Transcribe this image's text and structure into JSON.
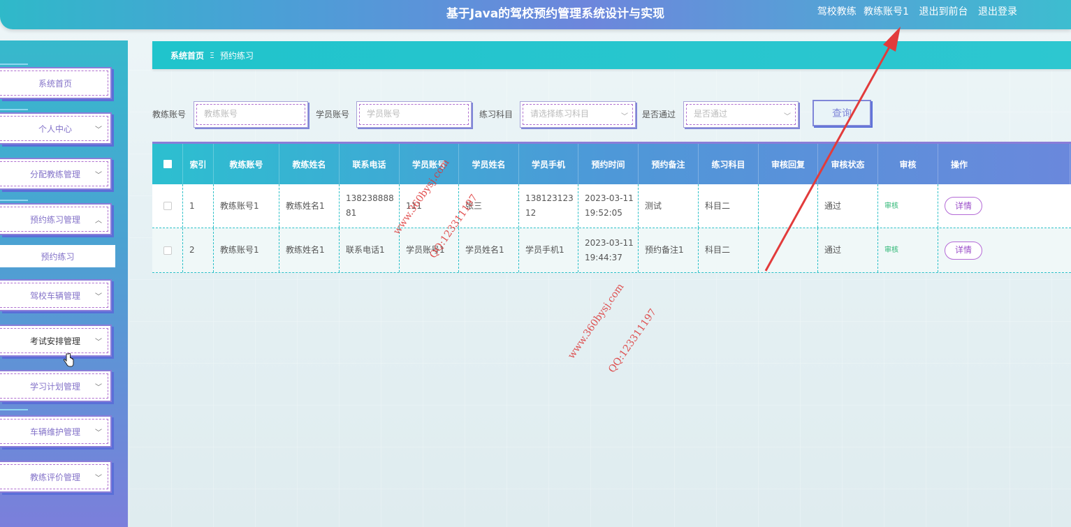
{
  "header": {
    "title": "基于Java的驾校预约管理系统设计与实现",
    "role": "驾校教练",
    "user": "教练账号1",
    "to_front": "退出到前台",
    "logout": "退出登录"
  },
  "sidebar": {
    "items": [
      {
        "label": "系统首页"
      },
      {
        "label": "个人中心"
      },
      {
        "label": "分配教练管理"
      },
      {
        "label": "预约练习管理"
      },
      {
        "label": "驾校车辆管理"
      },
      {
        "label": "考试安排管理"
      },
      {
        "label": "学习计划管理"
      },
      {
        "label": "车辆维护管理"
      },
      {
        "label": "教练评价管理"
      }
    ],
    "sub_item": "预约练习"
  },
  "breadcrumb": {
    "home": "系统首页",
    "separator": "Ξ",
    "current": "预约练习"
  },
  "search": {
    "coach_label": "教练账号",
    "coach_placeholder": "教练账号",
    "student_label": "学员账号",
    "student_placeholder": "学员账号",
    "subject_label": "练习科目",
    "subject_placeholder": "请选择练习科目",
    "pass_label": "是否通过",
    "pass_placeholder": "是否通过",
    "query_button": "查询"
  },
  "table": {
    "headers": [
      "索引",
      "教练账号",
      "教练姓名",
      "联系电话",
      "学员账号",
      "学员姓名",
      "学员手机",
      "预约时间",
      "预约备注",
      "练习科目",
      "审核回复",
      "审核状态",
      "审核",
      "操作"
    ],
    "rows": [
      {
        "index": "1",
        "coach_account": "教练账号1",
        "coach_name": "教练姓名1",
        "phone": "13823888881",
        "student_account": "111",
        "student_name": "张三",
        "student_phone": "13812312312",
        "time": "2023-03-11 19:52:05",
        "remark": "测试",
        "subject": "科目二",
        "reply": "",
        "status": "通过",
        "audit": "审核",
        "action": "详情"
      },
      {
        "index": "2",
        "coach_account": "教练账号1",
        "coach_name": "教练姓名1",
        "phone": "联系电话1",
        "student_account": "学员账号1",
        "student_name": "学员姓名1",
        "student_phone": "学员手机1",
        "time": "2023-03-11 19:44:37",
        "remark": "预约备注1",
        "subject": "科目二",
        "reply": "",
        "status": "通过",
        "audit": "审核",
        "action": "详情"
      }
    ]
  },
  "watermarks": {
    "site": "www.360bysj.com",
    "qq": "QQ:123311197"
  },
  "colors": {
    "accent": "#2bc0c8",
    "purple": "#8473c9",
    "arrow": "#e23b3b"
  }
}
